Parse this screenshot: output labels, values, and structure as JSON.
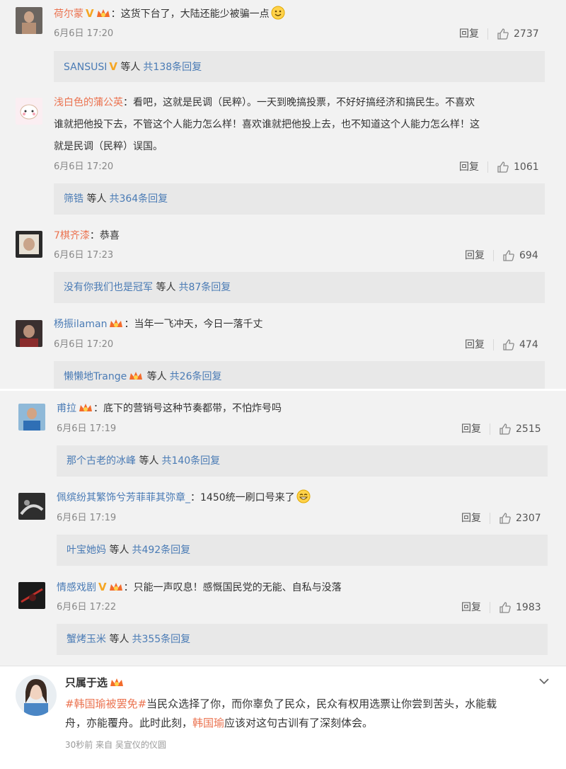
{
  "comments": [
    {
      "user": "荷尔蒙",
      "badge_v": "V",
      "text": "：这货下台了，大陆还能少被骗一点",
      "time": "6月6日 17:20",
      "reply_label": "回复",
      "likes": "2737",
      "reply_user": "SANSUSI",
      "reply_badge_v": "V",
      "reply_and": "等人",
      "reply_count": "共138条回复"
    },
    {
      "user": "浅白色的蒲公英",
      "text_1": "：看吧，这就是民调（民粹）。一天到晚搞投票，不好好搞经济和搞民生。不喜欢",
      "text_2": "谁就把他投下去，不管这个人能力怎么样！喜欢谁就把他投上去，也不知道这个人能力怎么样！这",
      "text_3": "就是民调（民粹）误国。",
      "time": "6月6日 17:20",
      "reply_label": "回复",
      "likes": "1061",
      "reply_user": "筛锆",
      "reply_and": "等人",
      "reply_count": "共364条回复"
    },
    {
      "user": "7棋齐漆",
      "text": "：恭喜",
      "time": "6月6日 17:23",
      "reply_label": "回复",
      "likes": "694",
      "reply_user": "没有你我们也是冠军",
      "reply_and": "等人",
      "reply_count": "共87条回复"
    },
    {
      "user": "杨振ilaman",
      "text": "：当年一飞冲天，今日一落千丈",
      "time": "6月6日 17:20",
      "reply_label": "回复",
      "likes": "474",
      "reply_user": "懒懒地Trange",
      "reply_and": "等人",
      "reply_count": "共26条回复"
    },
    {
      "user": "甫拉",
      "text": "：底下的营销号这种节奏都带，不怕炸号吗",
      "time": "6月6日 17:19",
      "reply_label": "回复",
      "likes": "2515",
      "reply_user": "那个古老的冰峰",
      "reply_and": "等人",
      "reply_count": "共140条回复"
    },
    {
      "user": "佩缤纷其繁饰兮芳菲菲其弥章_",
      "text": "：1450统一刷口号来了",
      "time": "6月6日 17:19",
      "reply_label": "回复",
      "likes": "2307",
      "reply_user": "叶宝她妈",
      "reply_and": "等人",
      "reply_count": "共492条回复"
    },
    {
      "user": "情感戏剧",
      "badge_v": "V",
      "text": "：只能一声叹息！感慨国民党的无能、自私与没落",
      "time": "6月6日 17:22",
      "reply_label": "回复",
      "likes": "1983",
      "reply_user": "蟹烤玉米",
      "reply_and": "等人",
      "reply_count": "共355条回复"
    }
  ],
  "post": {
    "user": "只属于选",
    "hashtag": "#韩国瑜被罢免#",
    "body_1": "当民众选择了你，而你辜负了民众，民众有权用选票让你尝到苦头，水能载",
    "body_2a": "舟，亦能覆舟。此时此刻，",
    "mention": "韩国瑜",
    "body_2b": "应该对这句古训有了深刻体会。",
    "meta": "30秒前  来自 吴宣仪的仪圆"
  },
  "colors": {
    "accent": "#eb7350",
    "link": "#4a7bb5",
    "badge": "#f5a623"
  }
}
